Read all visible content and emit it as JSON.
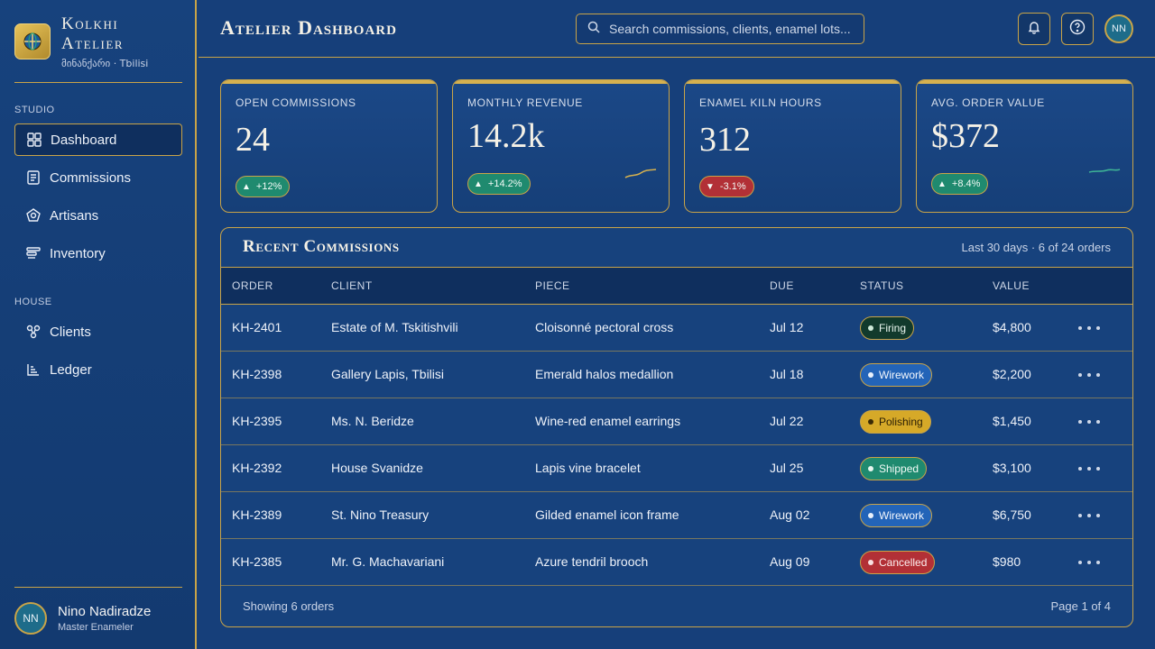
{
  "sidebar": {
    "brand_name_line1": "Kolkhi",
    "brand_name_line2": "Atelier",
    "brand_sub": "მინანქარი · Tbilisi",
    "section_studio": "STUDIO",
    "section_house": "HOUSE",
    "items": [
      {
        "label": "Dashboard",
        "icon": "grid-icon",
        "active": true
      },
      {
        "label": "Commissions",
        "icon": "document-icon"
      },
      {
        "label": "Artisans",
        "icon": "pentagon-icon"
      },
      {
        "label": "Inventory",
        "icon": "stack-icon"
      },
      {
        "label": "Clients",
        "icon": "clients-icon"
      },
      {
        "label": "Ledger",
        "icon": "ledger-icon"
      }
    ],
    "user": {
      "initials": "NN",
      "name": "Nino Nadiradze",
      "role": "Master Enameler"
    }
  },
  "header": {
    "title": "Atelier Dashboard",
    "search_placeholder": "Search commissions, clients, enamel lots...",
    "avatar_initials": "NN"
  },
  "stats": [
    {
      "label": "Open Commissions",
      "value": "24",
      "change": "+12%",
      "direction": "up"
    },
    {
      "label": "Monthly Revenue",
      "value": "14.2k",
      "change": "+14.2%",
      "direction": "up"
    },
    {
      "label": "Enamel Kiln Hours",
      "value": "312",
      "change": "-3.1%",
      "direction": "down"
    },
    {
      "label": "Avg. Order Value",
      "value": "$372",
      "change": "+8.4%",
      "direction": "up"
    }
  ],
  "commissions": {
    "title": "Recent Commissions",
    "meta": "Last 30 days · 6 of 24 orders",
    "columns": [
      "Order",
      "Client",
      "Piece",
      "Due",
      "Status",
      "Value"
    ],
    "rows": [
      {
        "order": "KH-2401",
        "client": "Estate of M. Tskitishvili",
        "piece": "Cloisonné pectoral cross",
        "due": "Jul 12",
        "status": "Firing",
        "value": "$4,800"
      },
      {
        "order": "KH-2398",
        "client": "Gallery Lapis, Tbilisi",
        "piece": "Emerald halos medallion",
        "due": "Jul 18",
        "status": "Wirework",
        "value": "$2,200"
      },
      {
        "order": "KH-2395",
        "client": "Ms. N. Beridze",
        "piece": "Wine-red enamel earrings",
        "due": "Jul 22",
        "status": "Polishing",
        "value": "$1,450"
      },
      {
        "order": "KH-2392",
        "client": "House Svanidze",
        "piece": "Lapis vine bracelet",
        "due": "Jul 25",
        "status": "Shipped",
        "value": "$3,100"
      },
      {
        "order": "KH-2389",
        "client": "St. Nino Treasury",
        "piece": "Gilded enamel icon frame",
        "due": "Aug 02",
        "status": "Wirework",
        "value": "$6,750"
      },
      {
        "order": "KH-2385",
        "client": "Mr. G. Machavariani",
        "piece": "Azure tendril brooch",
        "due": "Aug 09",
        "status": "Cancelled",
        "value": "$980"
      }
    ],
    "footer_left": "Showing 6 orders",
    "footer_right": "Page 1 of 4"
  },
  "status_colors": {
    "Firing": {
      "bg": "#123a2c",
      "dot": "#cfe9d9",
      "text": "#eaf6ef"
    },
    "Wirework": {
      "bg": "#2364b8",
      "dot": "#e8f0fb",
      "text": "#f3f7fd"
    },
    "Polishing": {
      "bg": "#d6a928",
      "dot": "#3a2a06",
      "text": "#2a1e05"
    },
    "Shipped": {
      "bg": "#1f8a6f",
      "dot": "#e6f6ef",
      "text": "#f3fbf7"
    },
    "Cancelled": {
      "bg": "#b23036",
      "dot": "#f8e1e2",
      "text": "#fcefef"
    }
  },
  "colors": {
    "accent": "#c9a448",
    "background": "#163f7a"
  }
}
